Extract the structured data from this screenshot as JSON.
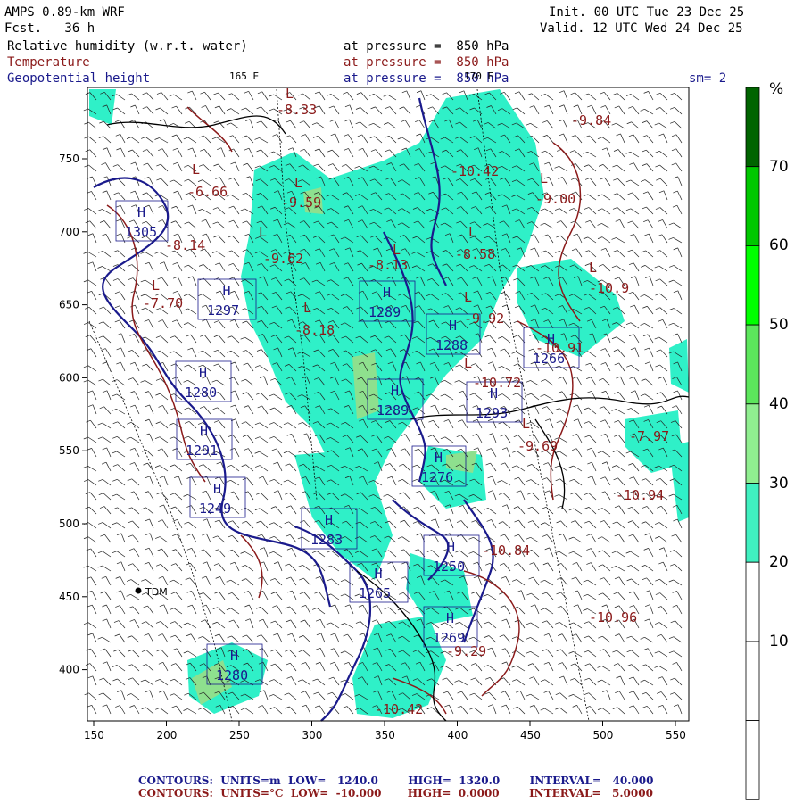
{
  "header": {
    "model": "AMPS 0.89-km WRF",
    "forecast": "Fcst.   36 h",
    "init": "Init. 00 UTC Tue 23 Dec 25",
    "valid": "Valid. 12 UTC Wed 24 Dec 25",
    "fields": [
      {
        "name": "Relative humidity (w.r.t. water)",
        "level": "at pressure =  850 hPa",
        "color": "#000000"
      },
      {
        "name": "Temperature",
        "level": "at pressure =  850 hPa",
        "color": "#8b1a1a"
      },
      {
        "name": "Geopotential height",
        "level": "at pressure =  850 hPa",
        "color": "#1a1a8c"
      }
    ],
    "smoothing": "sm= 2",
    "lon_label_1": "165 E",
    "lon_label_2": "170 E"
  },
  "axes": {
    "x_ticks": [
      "150",
      "200",
      "250",
      "300",
      "350",
      "400",
      "450",
      "500",
      "550"
    ],
    "y_ticks": [
      "750",
      "700",
      "650",
      "600",
      "550",
      "500",
      "450",
      "400"
    ]
  },
  "colorbar": {
    "unit": "%",
    "levels": [
      "70",
      "60",
      "50",
      "40",
      "30",
      "20",
      "10"
    ],
    "colors": [
      "#006400",
      "#00c800",
      "#00ff00",
      "#50e050",
      "#90ee90",
      "#40f0c0",
      "#ffffff",
      "#ffffff",
      "#ffffff"
    ]
  },
  "station": {
    "label": "TDM"
  },
  "map_labels": {
    "highs": [
      "H",
      "H",
      "H",
      "H",
      "H",
      "H",
      "H",
      "H",
      "H",
      "H",
      "H"
    ],
    "lows": [
      "L",
      "L",
      "L",
      "L",
      "L",
      "L",
      "L",
      "L",
      "L",
      "L",
      "L",
      "L",
      "L"
    ],
    "height_values": [
      "1305",
      "1297",
      "1289",
      "1288",
      "1266",
      "1280",
      "1289",
      "1293",
      "1291",
      "1249",
      "1283",
      "1276",
      "1265",
      "1250",
      "1280",
      "1269"
    ],
    "temp_values": [
      "-8.33",
      "-6.66",
      "-9.59",
      "-9.62",
      "-8.13",
      "-8.18",
      "-7.70",
      "-8.14",
      "-10.42",
      "-8.58",
      "-9.00",
      "-10.9",
      "-9.92",
      "-10.72",
      "-9.69",
      "-7.97",
      "-10.94",
      "-10.84",
      "-10.96",
      "-9.29",
      "-10.42",
      "-9.84",
      "-10.91"
    ]
  },
  "footer": {
    "line1": "CONTOURS:  UNITS=m  LOW=   1240.0        HIGH=  1320.0        INTERVAL=   40.000",
    "line2": "CONTOURS:  UNITS=°C  LOW=  -10.000       HIGH=  0.0000        INTERVAL=   5.0000"
  }
}
